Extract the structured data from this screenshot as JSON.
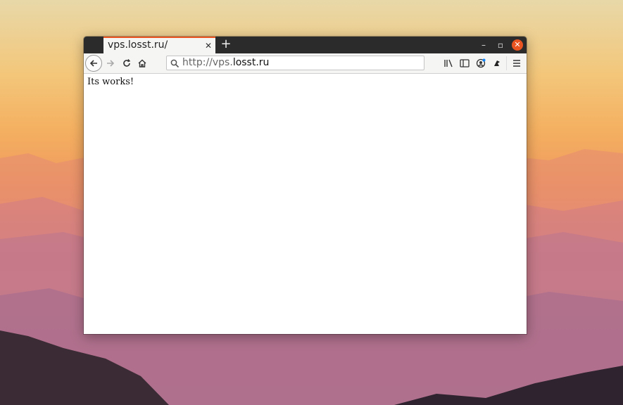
{
  "colors": {
    "tab_accent": "#e95420",
    "titlebar": "#2b2b2b",
    "toolbar": "#f5f5f4"
  },
  "browser": {
    "tab": {
      "title": "vps.losst.ru/",
      "close_icon": "close-icon"
    },
    "new_tab_icon": "plus-icon",
    "window_controls": {
      "minimize": "minimize-icon",
      "maximize": "maximize-icon",
      "close": "close-icon"
    },
    "nav": {
      "back": "arrow-left-icon",
      "forward": "arrow-right-icon",
      "reload": "reload-icon",
      "home": "home-icon"
    },
    "address": {
      "prefix": "http://vps.",
      "host": "losst.ru",
      "icon": "search-icon"
    },
    "toolbar_icons": [
      "library-icon",
      "sidebar-icon",
      "account-icon",
      "extension-icon",
      "menu-icon"
    ]
  },
  "page": {
    "body_text": "Its works!"
  }
}
